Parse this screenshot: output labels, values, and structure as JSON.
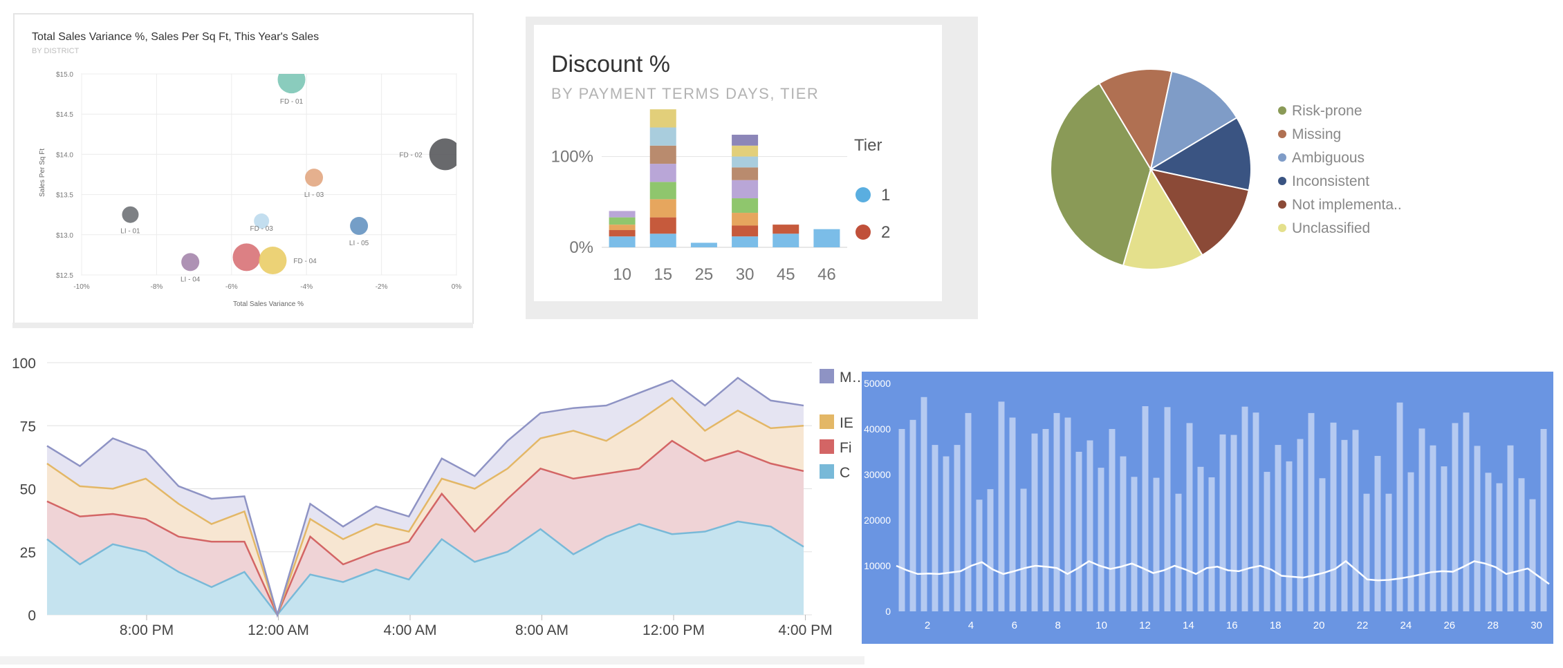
{
  "bubble": {
    "chart_data": {
      "type": "scatter",
      "title": "Total Sales Variance %, Sales Per Sq Ft, This Year's Sales",
      "subtitle": "BY DISTRICT",
      "xlabel": "Total Sales Variance %",
      "ylabel": "Sales Per Sq Ft",
      "xlim": [
        -10,
        0
      ],
      "ylim": [
        12.5,
        15.0
      ],
      "x_ticks": [
        "-10%",
        "-8%",
        "-6%",
        "-4%",
        "-2%",
        "0%"
      ],
      "y_ticks": [
        "$12.5",
        "$13.0",
        "$13.5",
        "$14.0",
        "$14.5",
        "$15.0"
      ],
      "points": [
        {
          "label": "FD - 01",
          "x": -4.4,
          "y": 14.93,
          "size": 20,
          "color": "#76c3b1"
        },
        {
          "label": "FD - 02",
          "x": -0.3,
          "y": 14.0,
          "size": 23,
          "color": "#4d4f52"
        },
        {
          "label": "LI - 03",
          "x": -3.8,
          "y": 13.71,
          "size": 13,
          "color": "#e0a27a"
        },
        {
          "label": "LI - 01",
          "x": -8.7,
          "y": 13.25,
          "size": 12,
          "color": "#666a6e"
        },
        {
          "label": "LI - 05",
          "x": -2.6,
          "y": 13.11,
          "size": 13,
          "color": "#5c8dbd"
        },
        {
          "label": "FD - 03",
          "x": -5.2,
          "y": 13.17,
          "size": 11,
          "color": "#b8d8ec"
        },
        {
          "label": "LI - 04",
          "x": -7.1,
          "y": 12.66,
          "size": 13,
          "color": "#a07fa7"
        },
        {
          "label": "",
          "x": -5.6,
          "y": 12.72,
          "size": 20,
          "color": "#d66a6e"
        },
        {
          "label": "FD - 04",
          "x": -4.9,
          "y": 12.68,
          "size": 20,
          "color": "#e9ca5e"
        }
      ]
    }
  },
  "discount": {
    "chart_data": {
      "type": "bar",
      "title": "Discount %",
      "subtitle": "BY PAYMENT TERMS DAYS, TIER",
      "categories": [
        "10",
        "15",
        "25",
        "30",
        "45",
        "46"
      ],
      "y_ticks": [
        "100%",
        "0%"
      ],
      "ylim": [
        0,
        140
      ],
      "legend_title": "Tier",
      "legend": [
        {
          "name": "1",
          "color": "#5aaee0"
        },
        {
          "name": "2",
          "color": "#c0503a"
        }
      ],
      "stacks": [
        [
          12,
          7,
          6,
          8,
          7
        ],
        [
          15,
          18,
          20,
          19,
          20,
          20,
          20,
          20
        ],
        [
          5
        ],
        [
          12,
          12,
          14,
          16,
          20,
          14,
          12,
          12,
          12
        ],
        [
          15,
          10
        ],
        [
          20
        ]
      ],
      "palette": [
        "#7bbde8",
        "#c65a3c",
        "#e6a65e",
        "#8fc66d",
        "#b9a6d7",
        "#b98b6e",
        "#a9cddd",
        "#e2cf7a",
        "#8c86b8"
      ]
    }
  },
  "pie": {
    "chart_data": {
      "type": "pie",
      "slices": [
        {
          "name": "Risk-prone",
          "value": 34,
          "color": "#8a9a57"
        },
        {
          "name": "Missing",
          "value": 11,
          "color": "#b07052"
        },
        {
          "name": "Ambiguous",
          "value": 12,
          "color": "#7f9cc7"
        },
        {
          "name": "Inconsistent",
          "value": 11,
          "color": "#3a5482"
        },
        {
          "name": "Not implementa..",
          "value": 12,
          "color": "#8b4a37"
        },
        {
          "name": "Unclassified",
          "value": 12,
          "color": "#e4e08c"
        }
      ]
    }
  },
  "area": {
    "chart_data": {
      "type": "area",
      "ylim": [
        0,
        100
      ],
      "y_ticks": [
        "100",
        "75",
        "50",
        "25",
        "0"
      ],
      "x_tick_labels": [
        "8:00 PM",
        "12:00 AM",
        "4:00 AM",
        "8:00 AM",
        "12:00 PM",
        "4:00 PM"
      ],
      "x_tick_index": [
        4,
        10,
        16,
        22,
        28,
        34
      ],
      "legend": [
        {
          "name": "M… S…",
          "color": "#8e93c4"
        },
        {
          "name": "IE",
          "color": "#e3b766"
        },
        {
          "name": "Fi",
          "color": "#d36565"
        },
        {
          "name": "C",
          "color": "#78b9d8"
        }
      ],
      "series": [
        {
          "name": "C",
          "color": "#78b9d8",
          "fill": "#c5e3ef",
          "values": [
            30,
            20,
            28,
            25,
            17,
            11,
            17,
            0,
            16,
            13,
            18,
            14,
            30,
            21,
            25,
            34,
            24,
            31,
            36,
            32,
            33,
            37,
            35,
            27
          ]
        },
        {
          "name": "Fi",
          "color": "#d36565",
          "fill": "#efd3d6",
          "values": [
            45,
            39,
            40,
            38,
            31,
            29,
            29,
            0,
            31,
            20,
            25,
            29,
            48,
            33,
            46,
            58,
            54,
            56,
            58,
            69,
            61,
            65,
            60,
            57
          ]
        },
        {
          "name": "IE",
          "color": "#e3b766",
          "fill": "#f7e6d2",
          "values": [
            60,
            51,
            50,
            54,
            44,
            36,
            41,
            0,
            38,
            30,
            36,
            33,
            54,
            50,
            58,
            70,
            73,
            69,
            77,
            86,
            73,
            81,
            74,
            75
          ]
        },
        {
          "name": "M… S…",
          "color": "#8e93c4",
          "fill": "#e5e4f2",
          "values": [
            67,
            59,
            70,
            65,
            51,
            46,
            47,
            0,
            44,
            35,
            43,
            39,
            62,
            55,
            69,
            80,
            82,
            83,
            88,
            93,
            83,
            94,
            85,
            83
          ]
        }
      ]
    }
  },
  "blue_bars": {
    "chart_data": {
      "type": "bar",
      "ylim": [
        0,
        50000
      ],
      "y_ticks": [
        "50000",
        "40000",
        "30000",
        "20000",
        "10000",
        "0"
      ],
      "x_tick_labels": [
        "2",
        "4",
        "6",
        "8",
        "10",
        "12",
        "14",
        "16",
        "18",
        "20",
        "22",
        "24",
        "26",
        "28",
        "30"
      ],
      "values": [
        40000,
        42000,
        47000,
        36500,
        34000,
        36500,
        43500,
        24500,
        26800,
        46000,
        42500,
        26900,
        39000,
        40000,
        43500,
        42500,
        35000,
        37500,
        31500,
        40000,
        34000,
        29500,
        45000,
        29300,
        44800,
        25800,
        41300,
        31700,
        29400,
        38800,
        38700,
        44900,
        43600,
        30600,
        36500,
        32900,
        37800,
        43500,
        29200,
        41400,
        37600,
        39800,
        25800,
        34100,
        25800,
        45800,
        30500,
        40100,
        36400,
        31800,
        41300,
        43600,
        36300,
        30400,
        28100,
        36400,
        29200,
        24600,
        40000
      ],
      "line": [
        10000,
        9000,
        8200,
        8300,
        8200,
        8500,
        8800,
        10000,
        10800,
        9200,
        8200,
        8800,
        9500,
        10000,
        9800,
        9500,
        8200,
        9500,
        11000,
        10000,
        9300,
        9800,
        10500,
        9500,
        8400,
        9000,
        10000,
        9200,
        8200,
        9500,
        9800,
        9000,
        8800,
        9500,
        10000,
        9200,
        7800,
        7600,
        7400,
        7900,
        8500,
        9300,
        11000,
        9000,
        7000,
        6800,
        6900,
        7200,
        7600,
        8100,
        8600,
        8800,
        8700,
        9800,
        11000,
        10500,
        9700,
        8200,
        8800,
        9400,
        7700,
        6000
      ]
    }
  }
}
